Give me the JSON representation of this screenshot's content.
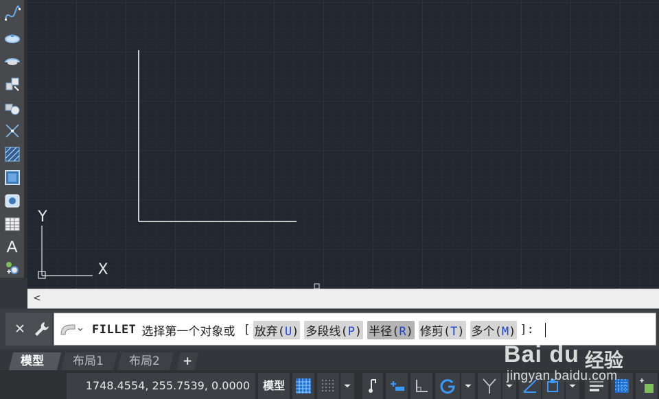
{
  "colors": {
    "canvas_bg": "#212830",
    "grid_minor": "#262e37",
    "grid_major": "#2e3741",
    "geometry": "#ffffff",
    "command_option": "#1a44d8"
  },
  "toolbar": {
    "tools": [
      {
        "name": "spline-tool",
        "icon": "spline-icon"
      },
      {
        "name": "ellipse-tool",
        "icon": "ellipse-icon"
      },
      {
        "name": "ellipse-arc-tool",
        "icon": "ellipse-arc-icon"
      },
      {
        "name": "insert-block-tool",
        "icon": "insert-block-icon"
      },
      {
        "name": "make-block-tool",
        "icon": "make-block-icon"
      },
      {
        "name": "point-tool",
        "icon": "point-icon"
      },
      {
        "name": "hatch-tool",
        "icon": "hatch-icon"
      },
      {
        "name": "gradient-tool",
        "icon": "gradient-icon"
      },
      {
        "name": "region-tool",
        "icon": "region-icon"
      },
      {
        "name": "table-tool",
        "icon": "table-icon"
      },
      {
        "name": "multiline-text-tool",
        "icon": "text-icon",
        "label": "A"
      },
      {
        "name": "add-selected-tool",
        "icon": "add-selected-icon"
      }
    ]
  },
  "ucs": {
    "x_label": "X",
    "y_label": "Y"
  },
  "hscroll": {
    "left_arrow": "<"
  },
  "command": {
    "close_glyph": "✕",
    "name": "FILLET",
    "prompt": "选择第一个对象或",
    "open_bracket": "[",
    "options": [
      {
        "label": "放弃",
        "key": "U",
        "selected": false
      },
      {
        "label": "多段线",
        "key": "P",
        "selected": false
      },
      {
        "label": "半径",
        "key": "R",
        "selected": true
      },
      {
        "label": "修剪",
        "key": "T",
        "selected": false
      },
      {
        "label": "多个",
        "key": "M",
        "selected": false
      }
    ],
    "close_bracket": "]:"
  },
  "tabs": {
    "model": "模型",
    "layout1": "布局1",
    "layout2": "布局2",
    "add": "+"
  },
  "status": {
    "coordinates": "1748.4554, 255.7539, 0.0000",
    "space": "模型"
  },
  "watermark": {
    "logo": "Bai du",
    "cn": "经验",
    "url": "jingyan.baidu.com"
  }
}
